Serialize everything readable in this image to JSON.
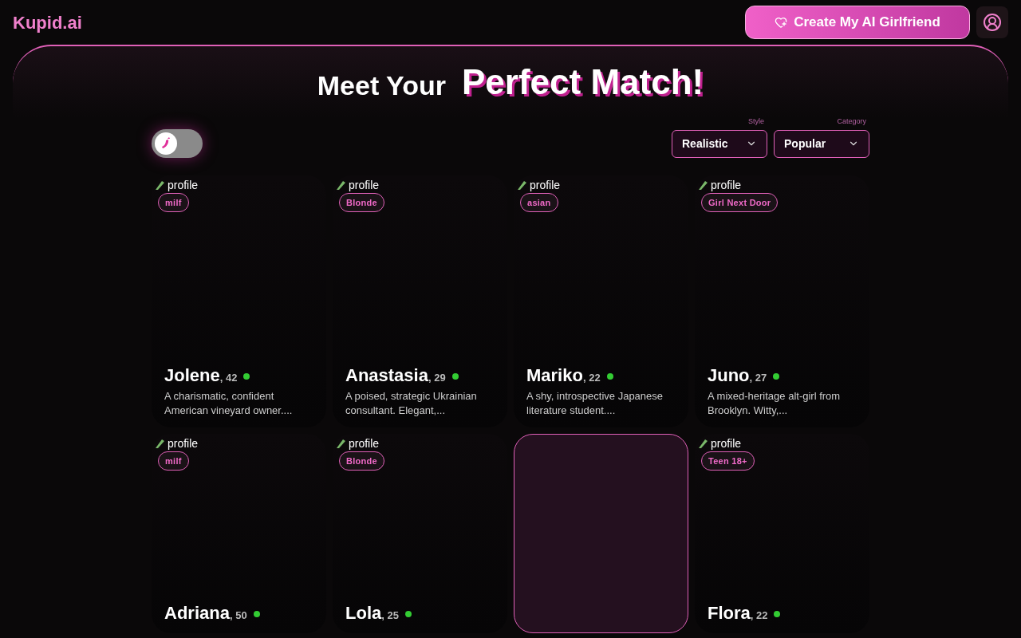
{
  "header": {
    "logo": "Kupid.ai",
    "create_button": "Create My AI Girlfriend"
  },
  "hero": {
    "title_lead": "Meet Your",
    "title_highlight": "Perfect Match!"
  },
  "controls": {
    "toggle": {
      "on": false
    },
    "filters": [
      {
        "label": "Style",
        "value": "Realistic"
      },
      {
        "label": "Category",
        "value": "Popular"
      }
    ]
  },
  "profiles": [
    {
      "kind": "profile",
      "image_alt": "profile",
      "tag": "milf",
      "name": "Jolene",
      "age": ", 42",
      "online": true,
      "description": "A charismatic, confident American vineyard owner...."
    },
    {
      "kind": "profile",
      "image_alt": "profile",
      "tag": "Blonde",
      "name": "Anastasia",
      "age": ", 29",
      "online": true,
      "description": "A poised, strategic Ukrainian consultant. Elegant,..."
    },
    {
      "kind": "profile",
      "image_alt": "profile",
      "tag": "asian",
      "name": "Mariko",
      "age": ", 22",
      "online": true,
      "description": "A shy, introspective Japanese literature student...."
    },
    {
      "kind": "profile",
      "image_alt": "profile",
      "tag": "Girl Next Door",
      "name": "Juno",
      "age": ", 27",
      "online": true,
      "description": "A mixed-heritage alt-girl from Brooklyn. Witty,..."
    },
    {
      "kind": "profile",
      "image_alt": "profile",
      "tag": "milf",
      "name": "Adriana",
      "age": ", 50",
      "online": true
    },
    {
      "kind": "profile",
      "image_alt": "profile",
      "tag": "Blonde",
      "name": "Lola",
      "age": ", 25",
      "online": true
    },
    {
      "kind": "placeholder"
    },
    {
      "kind": "profile",
      "image_alt": "profile",
      "tag": "Teen 18+",
      "name": "Flora",
      "age": ", 22",
      "online": true
    }
  ]
}
